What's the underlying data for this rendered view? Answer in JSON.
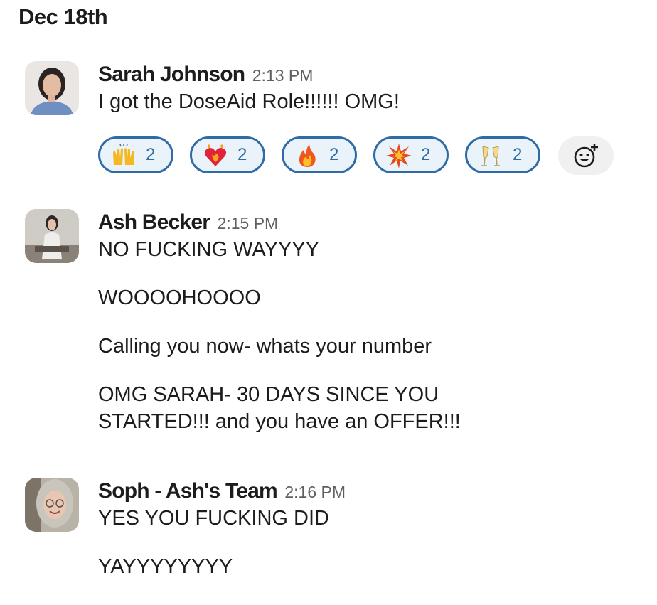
{
  "date_header": "Dec 18th",
  "messages": [
    {
      "sender": "Sarah Johnson",
      "time": "2:13 PM",
      "lines": [
        "I got the DoseAid Role!!!!!! OMG!"
      ],
      "avatar": "sarah-johnson-avatar",
      "reactions": [
        {
          "emoji": "raised-hands-emoji",
          "count": "2"
        },
        {
          "emoji": "heart-on-fire-emoji",
          "count": "2"
        },
        {
          "emoji": "fire-emoji",
          "count": "2"
        },
        {
          "emoji": "collision-emoji",
          "count": "2"
        },
        {
          "emoji": "clinking-glasses-emoji",
          "count": "2"
        }
      ],
      "add_reaction_icon": "add-reaction-icon"
    },
    {
      "sender": "Ash Becker",
      "time": "2:15 PM",
      "avatar": "ash-becker-avatar",
      "lines": [
        "NO FUCKING WAYYYY",
        "WOOOOHOOOO",
        "Calling you now- whats your number",
        "OMG SARAH- 30 DAYS SINCE YOU",
        "STARTED!!! and you have an OFFER!!!"
      ]
    },
    {
      "sender": "Soph - Ash's Team",
      "time": "2:16 PM",
      "avatar": "soph-avatar",
      "lines": [
        "YES YOU FUCKING DID",
        "YAYYYYYYYY"
      ]
    }
  ],
  "colors": {
    "reaction_border": "#2f6ca5",
    "reaction_bg": "#eaf2fa",
    "text": "#1d1c1d",
    "timestamp": "#616061"
  }
}
